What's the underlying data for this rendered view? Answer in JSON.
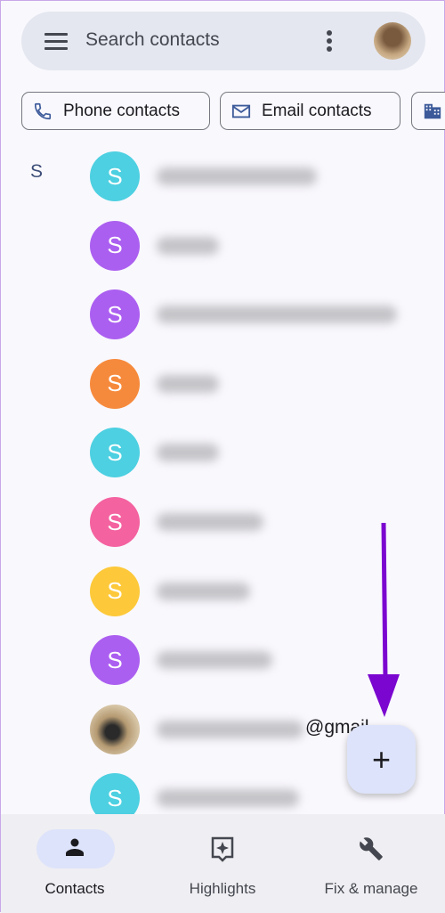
{
  "search": {
    "placeholder": "Search contacts",
    "menu_icon": "hamburger-icon",
    "more_icon": "more-vert-icon"
  },
  "filters": [
    {
      "label": "Phone contacts",
      "icon": "phone-icon"
    },
    {
      "label": "Email contacts",
      "icon": "mail-icon"
    },
    {
      "label": "",
      "icon": "business-icon"
    }
  ],
  "section_letter": "S",
  "contacts": [
    {
      "initial": "S",
      "color": "#4dd0e1"
    },
    {
      "initial": "S",
      "color": "#ab5ff0"
    },
    {
      "initial": "S",
      "color": "#ab5ff0"
    },
    {
      "initial": "S",
      "color": "#f68a3c"
    },
    {
      "initial": "S",
      "color": "#4dd0e1"
    },
    {
      "initial": "S",
      "color": "#f462a0"
    },
    {
      "initial": "S",
      "color": "#fdc93a"
    },
    {
      "initial": "S",
      "color": "#ab5ff0"
    },
    {
      "initial": "",
      "color": "photo",
      "email_suffix": "@gmail"
    },
    {
      "initial": "S",
      "color": "#4dd0e1"
    }
  ],
  "fab": {
    "label": "+",
    "icon": "add-icon"
  },
  "annotation_arrow_color": "#7b06d0",
  "nav": [
    {
      "label": "Contacts",
      "icon": "person-icon",
      "active": true
    },
    {
      "label": "Highlights",
      "icon": "highlights-icon"
    },
    {
      "label": "Fix & manage",
      "icon": "wrench-icon"
    }
  ]
}
